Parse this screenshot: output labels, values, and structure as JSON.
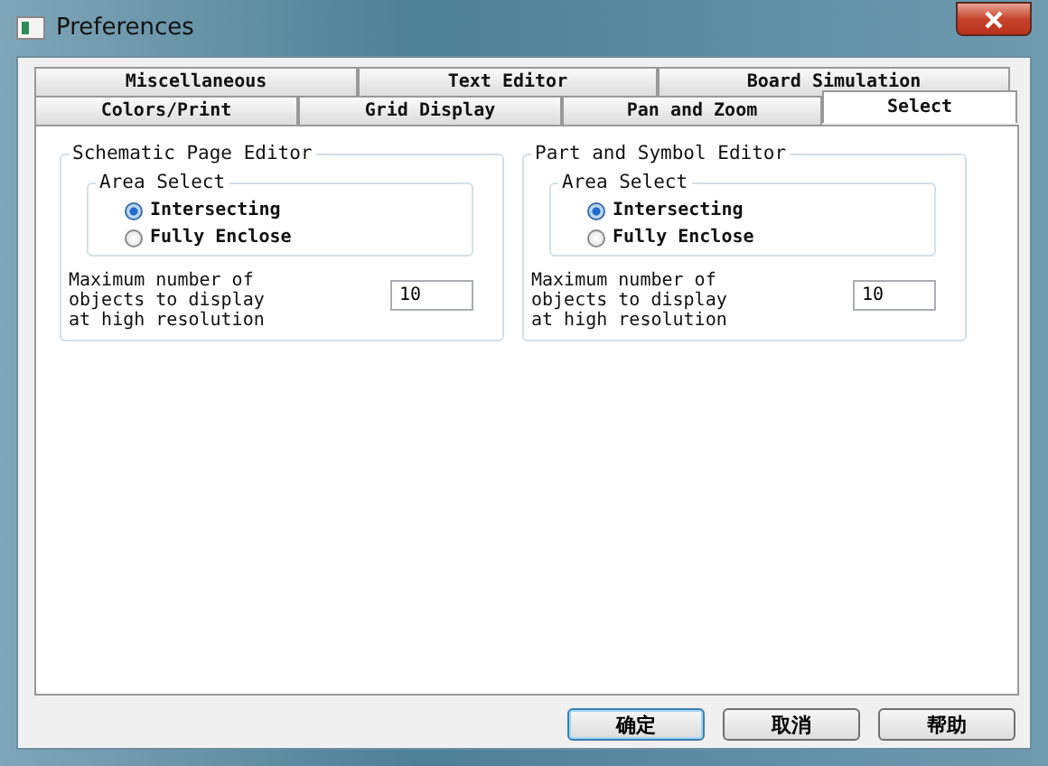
{
  "window": {
    "title": "Preferences"
  },
  "tab_rows": [
    {
      "tabs": [
        {
          "label": "Miscellaneous",
          "selected": false
        },
        {
          "label": "Text Editor",
          "selected": false
        },
        {
          "label": "Board Simulation",
          "selected": false
        }
      ]
    },
    {
      "tabs": [
        {
          "label": "Colors/Print",
          "selected": false
        },
        {
          "label": "Grid Display",
          "selected": false
        },
        {
          "label": "Pan and Zoom",
          "selected": false
        },
        {
          "label": "Select",
          "selected": true
        }
      ]
    }
  ],
  "groups": [
    {
      "title": "Schematic Page Editor",
      "area_select": {
        "title": "Area Select",
        "options": [
          {
            "label": "Intersecting",
            "selected": true
          },
          {
            "label": "Fully Enclose",
            "selected": false
          }
        ]
      },
      "max_objects": {
        "label": "Maximum number of objects to display at high resolution",
        "value": "10"
      }
    },
    {
      "title": "Part and Symbol Editor",
      "area_select": {
        "title": "Area Select",
        "options": [
          {
            "label": "Intersecting",
            "selected": true
          },
          {
            "label": "Fully Enclose",
            "selected": false
          }
        ]
      },
      "max_objects": {
        "label": "Maximum number of objects to display at high resolution",
        "value": "10"
      }
    }
  ],
  "buttons": [
    "确定",
    "取消",
    "帮助"
  ]
}
